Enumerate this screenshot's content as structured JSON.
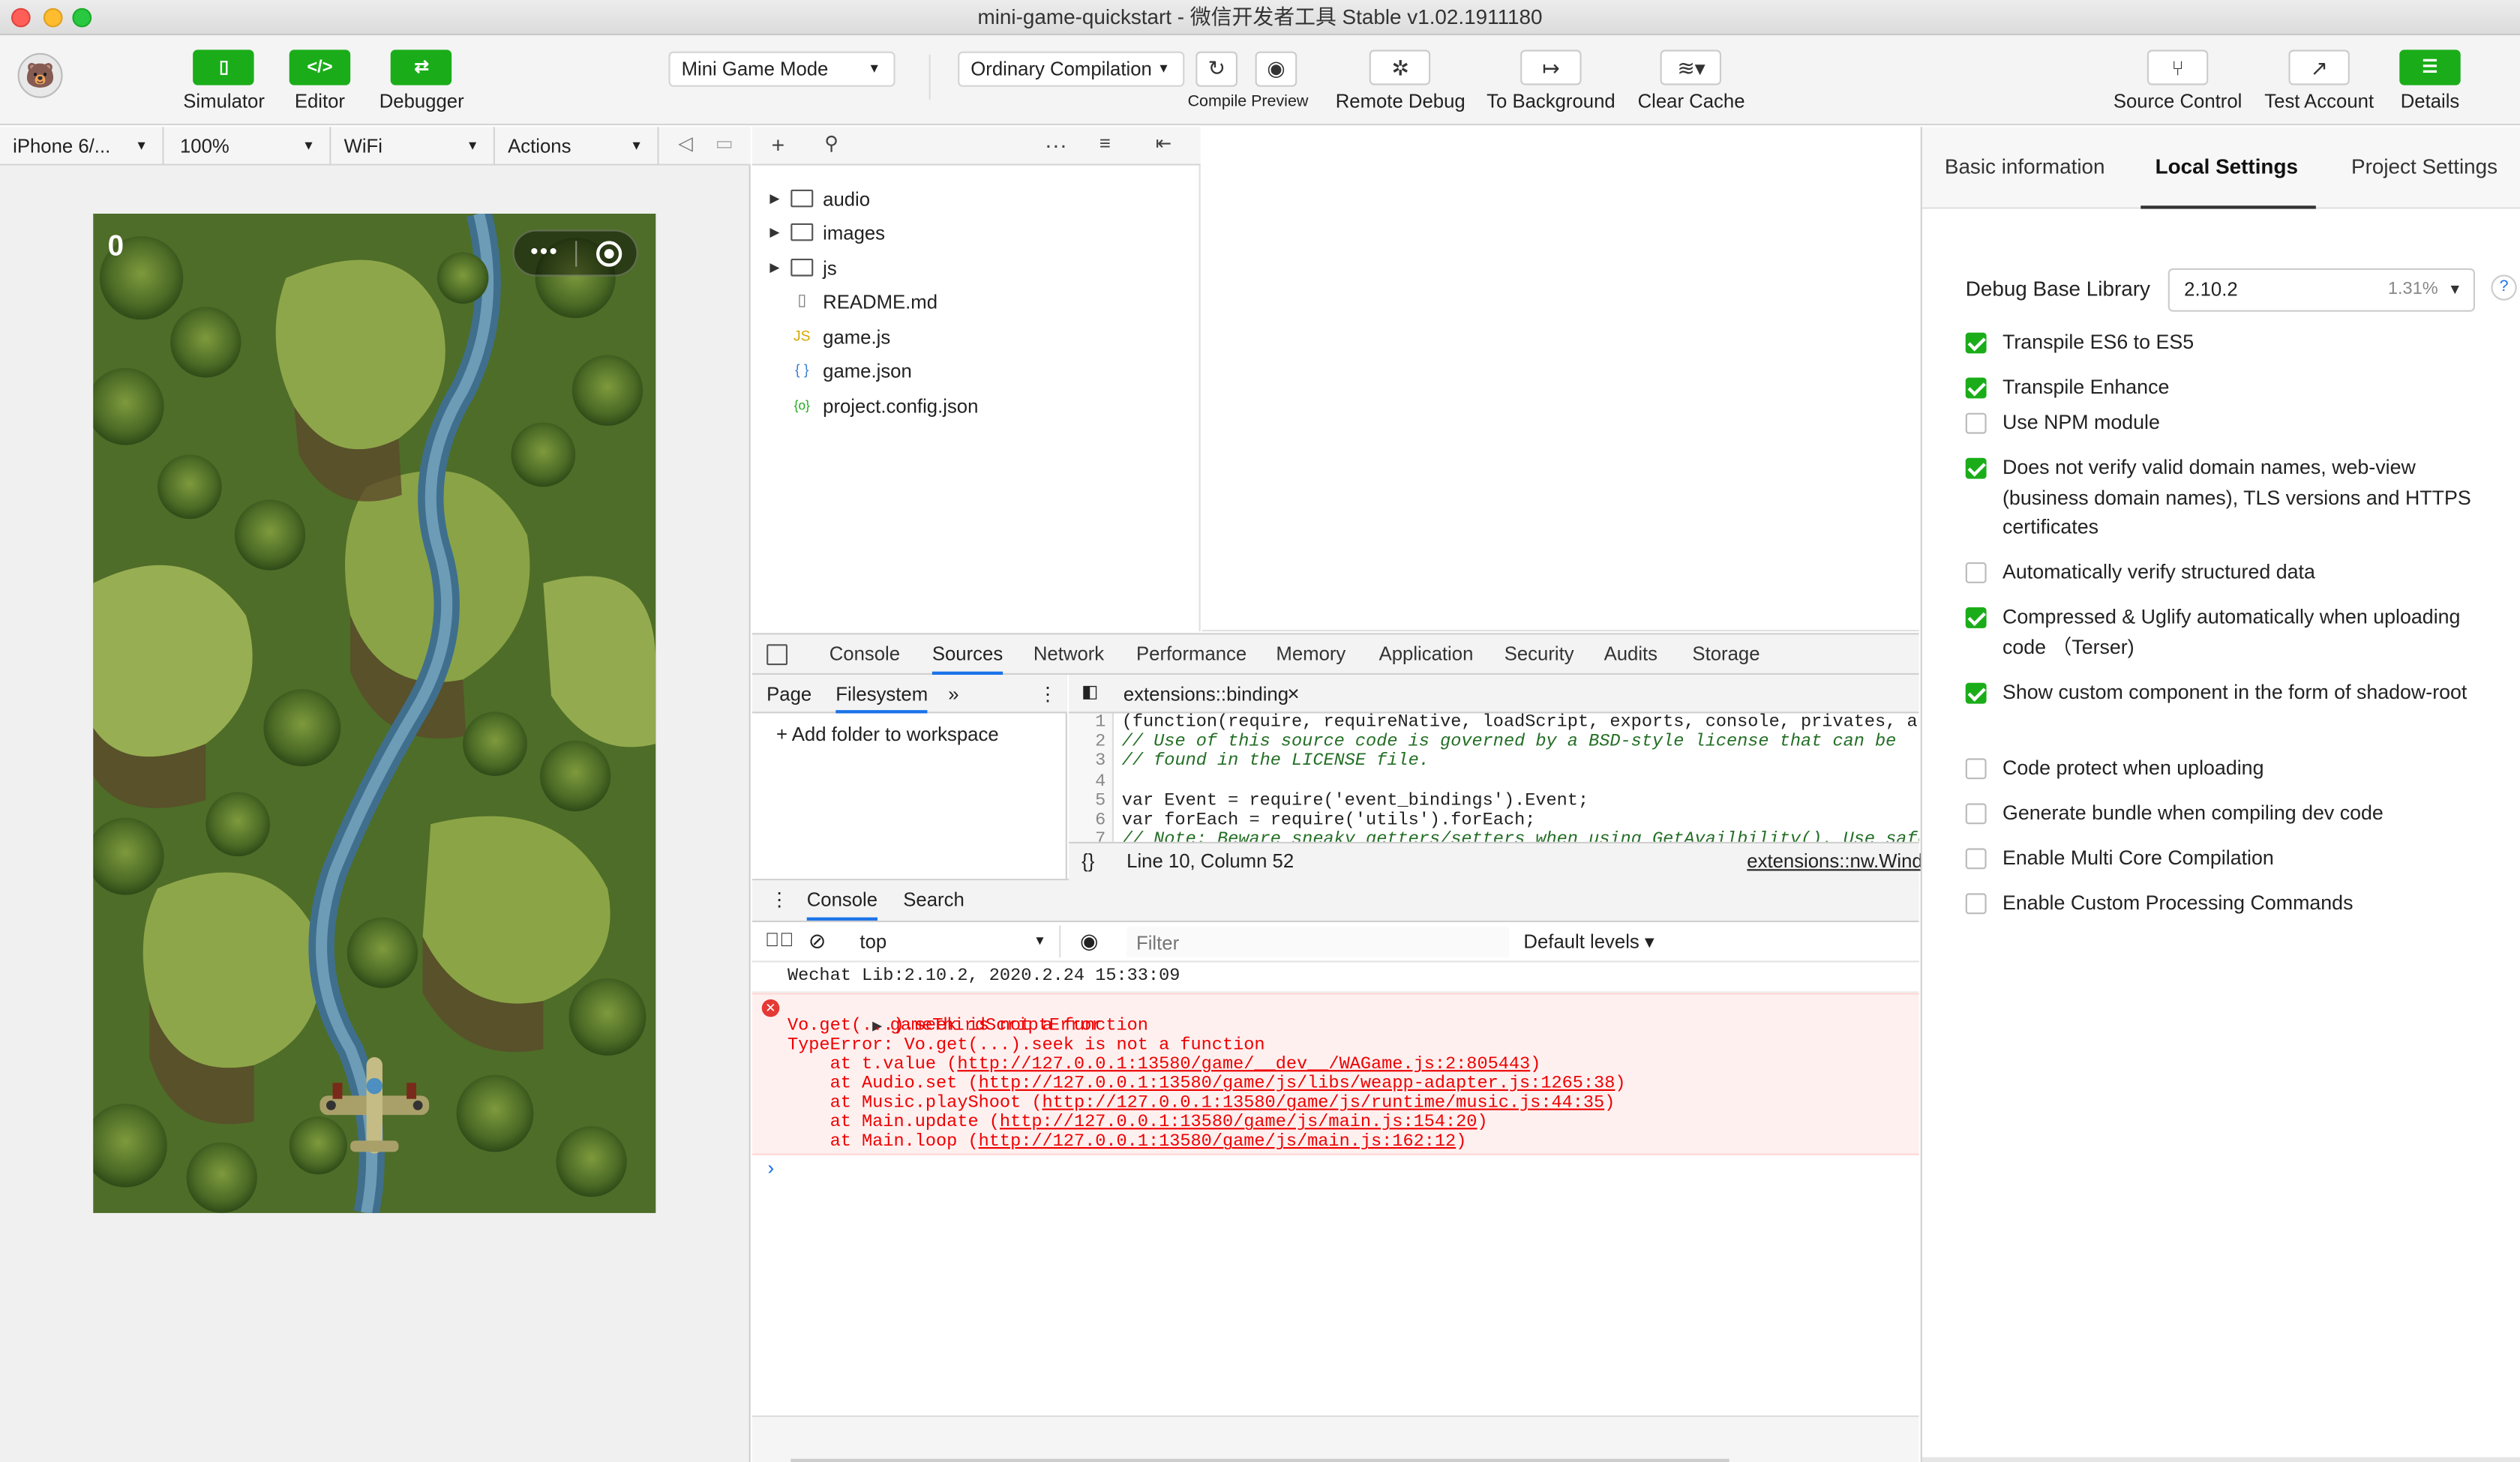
{
  "window": {
    "title": "mini-game-quickstart - 微信开发者工具 Stable v1.02.1911180"
  },
  "toolbar": {
    "simulator_label": "Simulator",
    "editor_label": "Editor",
    "debugger_label": "Debugger",
    "mode_select": "Mini Game Mode",
    "compile_select": "Ordinary Compilation",
    "compile_preview_label": "Compile Preview",
    "remote_debug_label": "Remote Debug",
    "to_background_label": "To Background",
    "clear_cache_label": "Clear Cache",
    "source_control_label": "Source Control",
    "test_account_label": "Test Account",
    "details_label": "Details",
    "accent_color": "#1aad19"
  },
  "simulator": {
    "device": "iPhone 6/...",
    "zoom": "100%",
    "network": "WiFi",
    "actions": "Actions",
    "game": {
      "score": "0"
    }
  },
  "file_tree": {
    "items": [
      {
        "name": "audio",
        "type": "folder"
      },
      {
        "name": "images",
        "type": "folder"
      },
      {
        "name": "js",
        "type": "folder"
      },
      {
        "name": "README.md",
        "type": "file"
      },
      {
        "name": "game.js",
        "type": "js"
      },
      {
        "name": "game.json",
        "type": "json"
      },
      {
        "name": "project.config.json",
        "type": "config"
      }
    ]
  },
  "devtools": {
    "tabs": [
      "Console",
      "Sources",
      "Network",
      "Performance",
      "Memory",
      "Application",
      "Security",
      "Audits",
      "Storage"
    ],
    "active_tab": "Sources",
    "sources": {
      "nav_tab_page": "Page",
      "nav_tab_filesystem": "Filesystem",
      "more_tabs": "»",
      "add_folder": "Add folder to workspace",
      "open_file": "extensions::binding",
      "close_x": "×",
      "code_lines": [
        "(function(require, requireNative, loadScript, exports, console, privates, apiBri",
        "// Use of this source code is governed by a BSD-style license that can be",
        "// found in the LICENSE file.",
        "",
        "var Event = require('event_bindings').Event;",
        "var forEach = require('utils').forEach;",
        "// Note: Beware sneaky getters/setters when using GetAvailbility(). Use safe/raw"
      ],
      "line_numbers": [
        "1",
        "2",
        "3",
        "4",
        "5",
        "6",
        "7"
      ],
      "status_position": "Line 10, Column 52",
      "status_source": "extensions::nw.Windo",
      "pretty_print": "{}"
    },
    "drawer": {
      "tab_console": "Console",
      "tab_search": "Search",
      "context": "top",
      "filter_placeholder": "Filter",
      "levels": "Default levels ▾"
    },
    "console": {
      "info": "Wechat Lib:2.10.2, 2020.2.24 15:33:09",
      "error_title": "gameThirdScriptError",
      "error_lines": [
        "Vo.get(...).seek is not a function",
        "TypeError: Vo.get(...).seek is not a function"
      ],
      "stack": [
        {
          "prefix": "    at t.value (",
          "link": "http://127.0.0.1:13580/game/__dev__/WAGame.js:2:805443",
          "suffix": ")"
        },
        {
          "prefix": "    at Audio.set (",
          "link": "http://127.0.0.1:13580/game/js/libs/weapp-adapter.js:1265:38",
          "suffix": ")"
        },
        {
          "prefix": "    at Music.playShoot (",
          "link": "http://127.0.0.1:13580/game/js/runtime/music.js:44:35",
          "suffix": ")"
        },
        {
          "prefix": "    at Main.update (",
          "link": "http://127.0.0.1:13580/game/js/main.js:154:20",
          "suffix": ")"
        },
        {
          "prefix": "    at Main.loop (",
          "link": "http://127.0.0.1:13580/game/js/main.js:162:12",
          "suffix": ")"
        }
      ],
      "prompt": "›"
    }
  },
  "details": {
    "tabs": [
      "Basic information",
      "Local Settings",
      "Project Settings"
    ],
    "active_tab": "Local Settings",
    "debug_lib_label": "Debug Base Library",
    "debug_lib_value": "2.10.2",
    "debug_lib_pct": "1.31%",
    "help": "?",
    "options": [
      {
        "label": "Transpile ES6 to ES5",
        "checked": true
      },
      {
        "label": "Transpile Enhance",
        "checked": true
      },
      {
        "label": "Use NPM module",
        "checked": false
      },
      {
        "label": "Does not verify valid domain names, web-view (business domain names), TLS versions and HTTPS certificates",
        "checked": true
      },
      {
        "label": "Automatically verify structured data",
        "checked": false
      },
      {
        "label": "Compressed & Uglify automatically when uploading code （Terser)",
        "checked": true
      },
      {
        "label": "Show custom component in the form of shadow-root",
        "checked": true
      },
      {
        "label": "Code protect when uploading",
        "checked": false
      },
      {
        "label": "Generate bundle when compiling dev code",
        "checked": false
      },
      {
        "label": "Enable Multi Core Compilation",
        "checked": false
      },
      {
        "label": "Enable Custom Processing Commands",
        "checked": false
      }
    ]
  }
}
